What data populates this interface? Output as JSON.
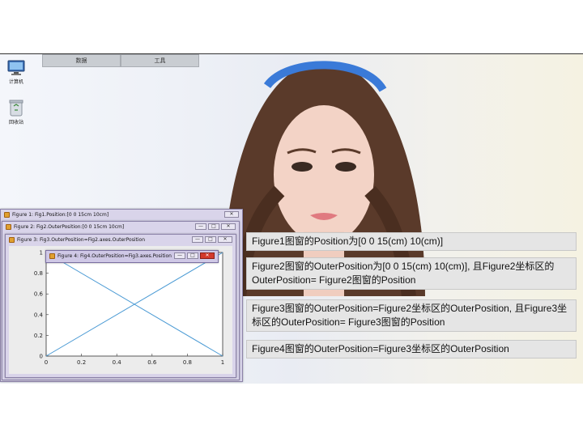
{
  "desktop": {
    "icons": [
      {
        "label": "计算机",
        "icon": "computer-icon"
      },
      {
        "label": "回收站",
        "icon": "recycle-bin-icon"
      }
    ]
  },
  "tabbar": {
    "tabs": [
      {
        "label": "数据"
      },
      {
        "label": "工具"
      }
    ]
  },
  "windows": {
    "fig1": {
      "title": "Figure 1: Fig1.Position:[0 0 15cm 10cm]"
    },
    "fig2": {
      "title": "Figure 2: Fig2.OuterPosition:[0 0 15cm 10cm]"
    },
    "fig3": {
      "title": "Figure 3: Fig3.OuterPosition=Fig2.axes.OuterPosition"
    },
    "fig4": {
      "title": "Figure 4: Fig4.OuterPosition=Fig3.axes.Position"
    }
  },
  "controls": {
    "minimize": "—",
    "maximize": "□",
    "close": "✕"
  },
  "chart_data": {
    "type": "line",
    "title": "",
    "xlabel": "",
    "ylabel": "",
    "xlim": [
      0,
      1
    ],
    "ylim": [
      0,
      1
    ],
    "x_ticks": [
      "0",
      "0.2",
      "0.4",
      "0.6",
      "0.8",
      "1"
    ],
    "y_ticks": [
      "0",
      "0.2",
      "0.4",
      "0.6",
      "0.8",
      "1"
    ],
    "series": [
      {
        "x": [
          0,
          1
        ],
        "y": [
          0,
          1
        ]
      },
      {
        "x": [
          0,
          1
        ],
        "y": [
          1,
          0
        ]
      }
    ],
    "line_color": "#4a9ad4"
  },
  "notes": [
    {
      "text": "Figure1图窗的Position为[0  0 15(cm) 10(cm)]"
    },
    {
      "text": "Figure2图窗的OuterPosition为[0  0 15(cm) 10(cm)], 且Figure2坐标区的OuterPosition= Figure2图窗的Position"
    },
    {
      "text": "Figure3图窗的OuterPosition=Figure2坐标区的OuterPosition, 且Figure3坐标区的OuterPosition= Figure3图窗的Position"
    },
    {
      "text": "Figure4图窗的OuterPosition=Figure3坐标区的OuterPosition"
    }
  ]
}
